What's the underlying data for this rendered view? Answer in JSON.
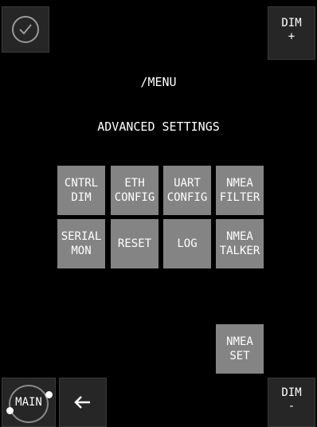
{
  "top_bar": {
    "dim_up_label": "DIM\n+"
  },
  "header": {
    "path_title": "/MENU",
    "section_title": "ADVANCED SETTINGS"
  },
  "menu": {
    "row1": [
      {
        "label": "CNTRL\nDIM"
      },
      {
        "label": "ETH\nCONFIG"
      },
      {
        "label": "UART\nCONFIG"
      },
      {
        "label": "NMEA\nFILTER"
      }
    ],
    "row2": [
      {
        "label": "SERIAL\nMON"
      },
      {
        "label": "RESET"
      },
      {
        "label": "LOG"
      },
      {
        "label": "NMEA\nTALKER"
      }
    ],
    "nmea_set_label": "NMEA\nSET"
  },
  "bottom_bar": {
    "main_label": "MAIN",
    "back_icon": "left-arrow-icon",
    "dim_down_label": "DIM\n-"
  },
  "colors": {
    "background": "#000000",
    "tile": "#848484",
    "corner_button": "#262626"
  }
}
